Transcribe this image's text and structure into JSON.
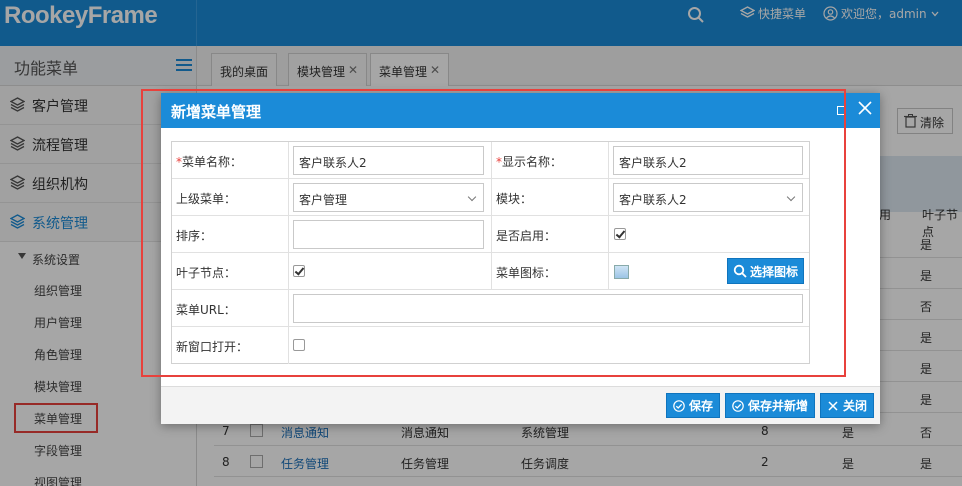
{
  "header": {
    "logo": "RookeyFrame",
    "quick_menu": "快捷菜单",
    "welcome": "欢迎您，admin"
  },
  "sidebar": {
    "title": "功能菜单",
    "groups": [
      {
        "label": "客户管理"
      },
      {
        "label": "流程管理"
      },
      {
        "label": "组织机构"
      },
      {
        "label": "系统管理"
      }
    ],
    "sub_group": "系统设置",
    "items": [
      {
        "label": "组织管理"
      },
      {
        "label": "用户管理"
      },
      {
        "label": "角色管理"
      },
      {
        "label": "模块管理"
      },
      {
        "label": "菜单管理"
      },
      {
        "label": "字段管理"
      },
      {
        "label": "视图管理"
      }
    ]
  },
  "tabs": [
    {
      "label": "我的桌面"
    },
    {
      "label": "模块管理",
      "close": "✕"
    },
    {
      "label": "菜单管理",
      "close": "✕"
    }
  ],
  "background": {
    "clear_button": "清除",
    "col_partial_1": "用",
    "col_partial_2": "叶子节点",
    "right_values": [
      {
        "a": "",
        "b": "是"
      },
      {
        "a": "",
        "b": "是"
      },
      {
        "a": "",
        "b": "否"
      },
      {
        "a": "",
        "b": "是"
      },
      {
        "a": "",
        "b": "是"
      },
      {
        "a": "",
        "b": "是"
      }
    ],
    "rows": [
      {
        "no": "7",
        "name": "消息通知",
        "display": "消息通知",
        "parent": "系统管理",
        "sort": "8",
        "enabled": "是",
        "leaf": "否"
      },
      {
        "no": "8",
        "name": "任务管理",
        "display": "任务管理",
        "parent": "任务调度",
        "sort": "2",
        "enabled": "是",
        "leaf": "是"
      }
    ]
  },
  "modal": {
    "title": "新增菜单管理",
    "fields": {
      "menu_name_label": "菜单名称：",
      "menu_name_value": "客户联系人2",
      "display_name_label": "显示名称：",
      "display_name_value": "客户联系人2",
      "parent_label": "上级菜单：",
      "parent_value": "客户管理",
      "module_label": "模块：",
      "module_value": "客户联系人2",
      "sort_label": "排序：",
      "sort_value": "",
      "enabled_label": "是否启用：",
      "leaf_label": "叶子节点：",
      "icon_label": "菜单图标：",
      "pick_icon": "选择图标",
      "url_label": "菜单URL：",
      "url_value": "",
      "newwin_label": "新窗口打开："
    },
    "required_mark": "*",
    "buttons": {
      "save": "保存",
      "save_new": "保存并新增",
      "close": "关闭"
    }
  },
  "colors": {
    "primary": "#1b8bd8",
    "highlight": "#e8413c"
  }
}
